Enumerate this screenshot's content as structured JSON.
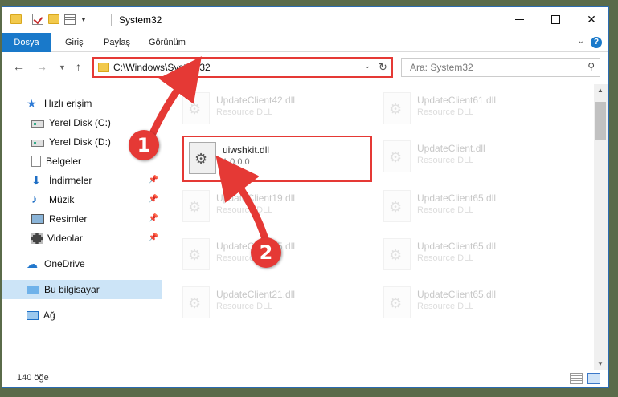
{
  "window": {
    "title": "System32"
  },
  "ribbon": {
    "tabs": [
      "Dosya",
      "Giriş",
      "Paylaş",
      "Görünüm"
    ]
  },
  "address": {
    "path": "C:\\Windows\\System32",
    "search_placeholder": "Ara: System32"
  },
  "nav": {
    "items": [
      {
        "label": "Hızlı erişim",
        "icon": "star-icon"
      },
      {
        "label": "Yerel Disk (C:)",
        "icon": "drive-icon"
      },
      {
        "label": "Yerel Disk (D:)",
        "icon": "drive-icon"
      },
      {
        "label": "Belgeler",
        "icon": "documents-icon"
      },
      {
        "label": "İndirmeler",
        "icon": "download-icon"
      },
      {
        "label": "Müzik",
        "icon": "music-icon"
      },
      {
        "label": "Resimler",
        "icon": "pictures-icon"
      },
      {
        "label": "Videolar",
        "icon": "video-icon"
      },
      {
        "label": "OneDrive",
        "icon": "cloud-icon"
      },
      {
        "label": "Bu bilgisayar",
        "icon": "computer-icon"
      },
      {
        "label": "Ağ",
        "icon": "network-icon"
      }
    ]
  },
  "files": [
    {
      "name": "UpdateClient42.dll",
      "type": "Resource DLL"
    },
    {
      "name": "UpdateClient61.dll",
      "type": "Resource DLL"
    },
    {
      "name": "uiwshkit.dll",
      "type": "1.0.0.0"
    },
    {
      "name": "UpdateClient.dll",
      "type": "Resource DLL"
    },
    {
      "name": "UpdateClient19.dll",
      "type": "Resource DLL"
    },
    {
      "name": "UpdateClient65.dll",
      "type": "Resource DLL"
    },
    {
      "name": "UpdateClient65.dll",
      "type": "Resource DLL"
    },
    {
      "name": "UpdateClient65.dll",
      "type": "Resource DLL"
    },
    {
      "name": "UpdateClient21.dll",
      "type": "Resource DLL"
    },
    {
      "name": "UpdateClient65.dll",
      "type": "Resource DLL"
    }
  ],
  "status": {
    "item_count": "140 öğe"
  },
  "annotations": {
    "marker1": "1",
    "marker2": "2",
    "color": "#e53935"
  }
}
